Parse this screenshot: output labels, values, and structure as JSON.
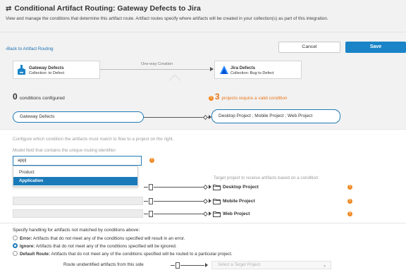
{
  "header": {
    "title": "Conditional Artifact Routing: Gateway Defects to Jira",
    "description": "View and manage the conditions that determine this artifact route. Artifact routes specify where artifacts will be created in your collection(s) as part of this integration."
  },
  "toolbar": {
    "back_label": "Back to Artifact Routing",
    "cancel_label": "Cancel",
    "save_label": "Save"
  },
  "flow": {
    "source": {
      "title": "Gateway Defects",
      "subtitle": "Collection: to Defect"
    },
    "label": "One-way Creation",
    "target": {
      "title": "Jira Defects",
      "subtitle": "Collection: Bug to Defect"
    }
  },
  "summary": {
    "conditions_count": "0",
    "conditions_label": "conditions configured",
    "invalid_count": "3",
    "invalid_label": "projects require a valid condition"
  },
  "pipeline": {
    "source": "Gateway Defects",
    "targets": "Desktop Project ; Mobile Project ; Web Project"
  },
  "config": {
    "instruction": "Configure which condition the artifacts must match to flow to a project on the right.",
    "model_field_label": "Model field that contains the unique routing identifier:",
    "model_field_value": "app|",
    "options": [
      "Product",
      "Application"
    ],
    "selected_option": "Application",
    "target_label": "Target project to receive artifacts based on a condition:",
    "projects": [
      "Desktop Project",
      "Mobile Project",
      "Web Project"
    ]
  },
  "unmatched": {
    "heading": "Specify handling for artifacts not matched by conditions above:",
    "options": [
      {
        "title": "Error:",
        "text": "Artifacts that do not meet any of the conditions specified will result in an error.",
        "selected": false
      },
      {
        "title": "Ignore:",
        "text": "Artifacts that do not meet any of the conditions specified will be ignored.",
        "selected": true
      },
      {
        "title": "Default Route:",
        "text": "Artifacts that do not meet any of the conditions specified will be routed to a particular project.",
        "selected": false
      }
    ],
    "route_label": "Route unidentified artifacts from this side",
    "select_placeholder": "Select a Target Project"
  },
  "colors": {
    "accent": "#1a84c7",
    "warning": "#f08a24",
    "jira": "#2684ff"
  },
  "icons": [
    "swap-arrows-icon",
    "download-icon",
    "jira-logo-icon",
    "warning-icon",
    "document-icon",
    "folder-icon",
    "chevron-down-icon"
  ]
}
